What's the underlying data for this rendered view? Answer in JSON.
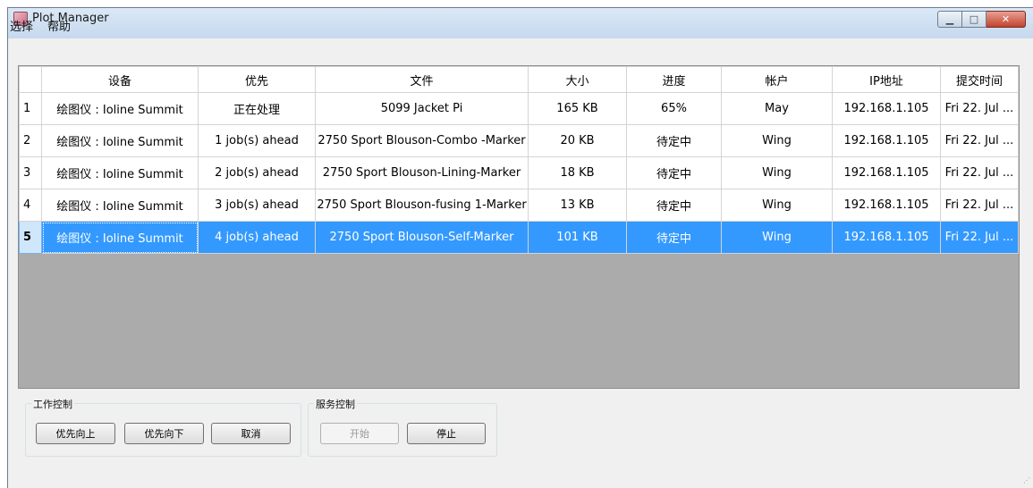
{
  "window": {
    "title": "Plot Manager"
  },
  "menu": [
    "选择",
    "帮助"
  ],
  "table": {
    "columns": [
      "设备",
      "优先",
      "文件",
      "大小",
      "进度",
      "帐户",
      "IP地址",
      "提交时间"
    ],
    "rows": [
      {
        "num": "1",
        "cells": [
          "绘图仪 : Ioline Summit",
          "正在处理",
          "5099 Jacket Pi",
          "165 KB",
          "65%",
          "May",
          "192.168.1.105",
          "Fri 22. Jul ..."
        ]
      },
      {
        "num": "2",
        "cells": [
          "绘图仪 : Ioline Summit",
          "1 job(s) ahead",
          "2750 Sport Blouson-Combo -Marker",
          "20 KB",
          "待定中",
          "Wing",
          "192.168.1.105",
          "Fri 22. Jul ..."
        ]
      },
      {
        "num": "3",
        "cells": [
          "绘图仪 : Ioline Summit",
          "2 job(s) ahead",
          "2750 Sport Blouson-Lining-Marker",
          "18 KB",
          "待定中",
          "Wing",
          "192.168.1.105",
          "Fri 22. Jul ..."
        ]
      },
      {
        "num": "4",
        "cells": [
          "绘图仪 : Ioline Summit",
          "3 job(s) ahead",
          "2750 Sport Blouson-fusing 1-Marker",
          "13 KB",
          "待定中",
          "Wing",
          "192.168.1.105",
          "Fri 22. Jul ..."
        ]
      },
      {
        "num": "5",
        "cells": [
          "绘图仪 : Ioline Summit",
          "4 job(s) ahead",
          "2750 Sport Blouson-Self-Marker",
          "101 KB",
          "待定中",
          "Wing",
          "192.168.1.105",
          "Fri 22. Jul ..."
        ]
      }
    ],
    "selected_row": "5"
  },
  "job_control": {
    "label": "工作控制",
    "buttons": [
      "优先向上",
      "优先向下",
      "取消"
    ]
  },
  "service_control": {
    "label": "服务控制",
    "start": "开始",
    "stop": "停止"
  },
  "colors": {
    "selection": "#3399ff",
    "grid_bg": "#ababab"
  },
  "icons": [
    "app-icon",
    "minimize-icon",
    "maximize-icon",
    "close-icon",
    "resize-grip-icon"
  ]
}
